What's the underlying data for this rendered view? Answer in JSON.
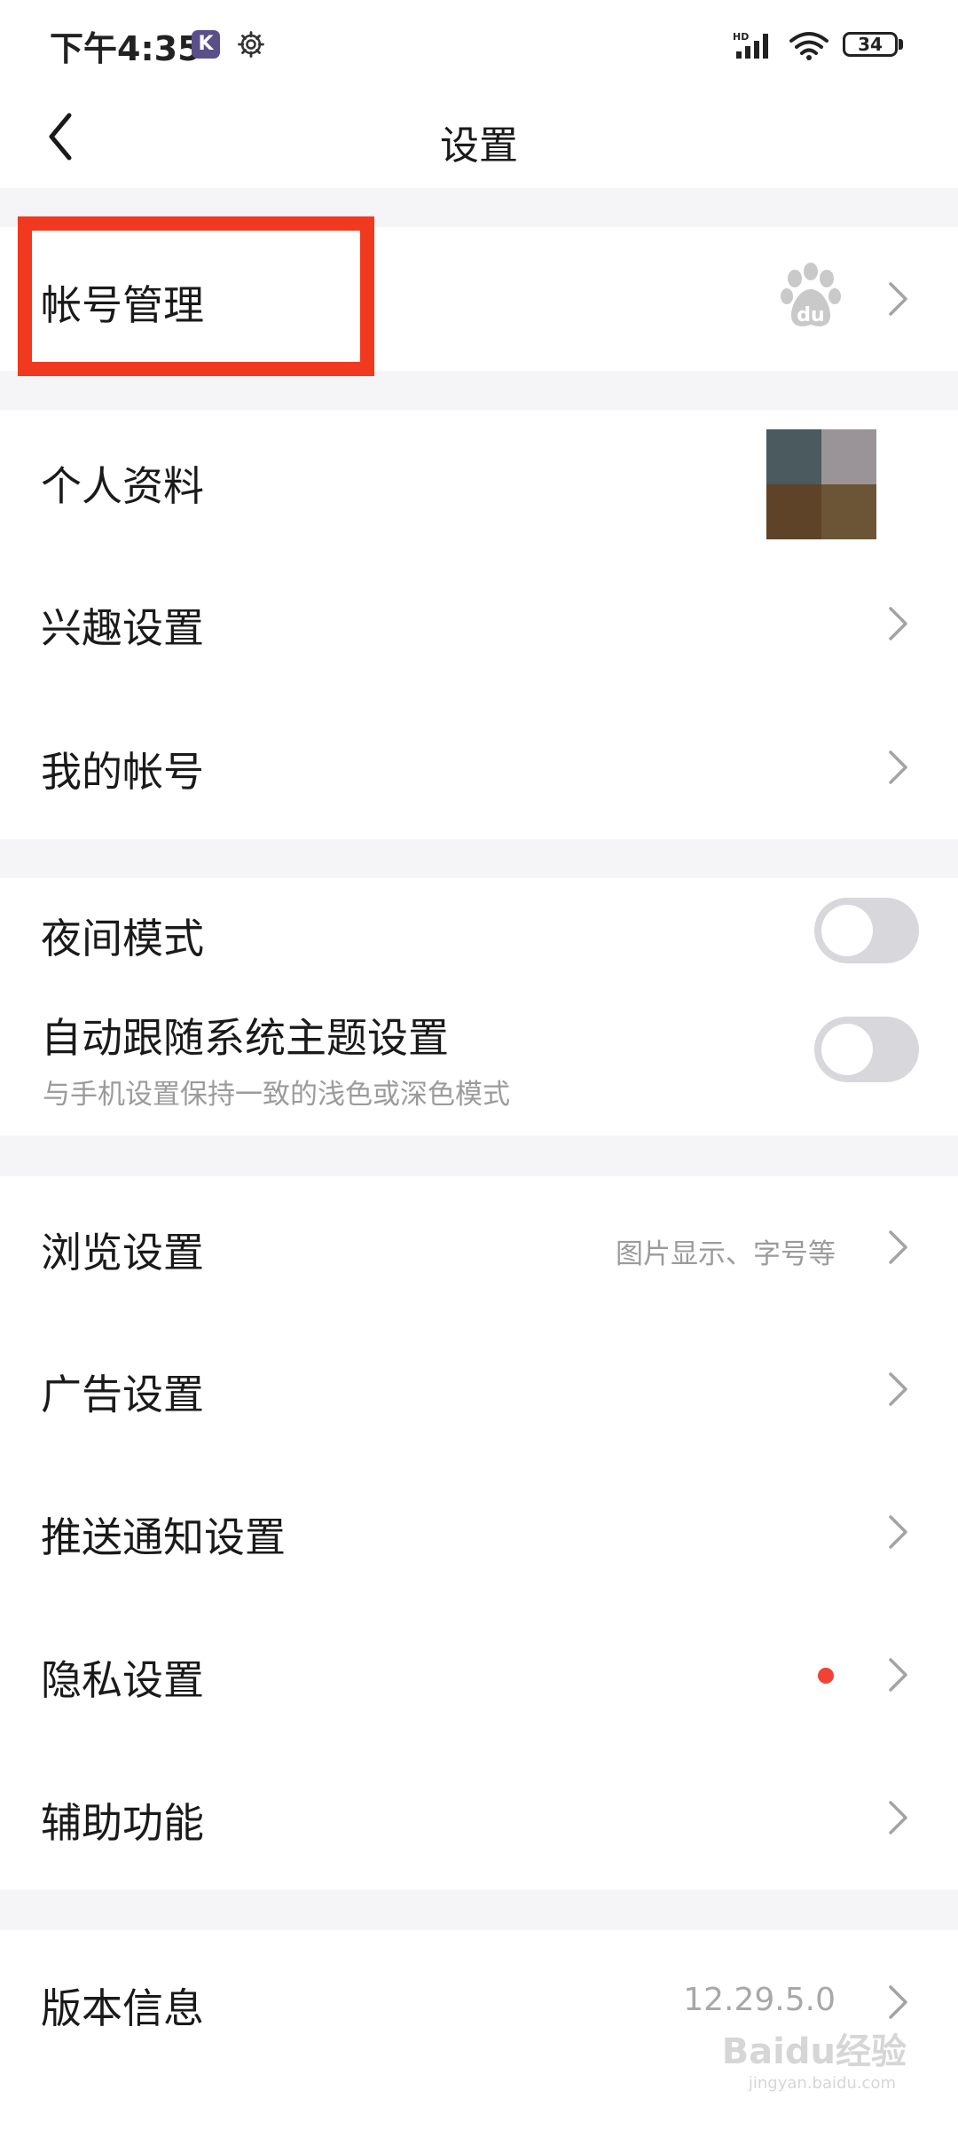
{
  "status_bar": {
    "time": "下午4:35",
    "app_badge": "K",
    "battery": "34"
  },
  "nav": {
    "title": "设置"
  },
  "account_group": {
    "account_management": "帐号管理"
  },
  "profile_group": {
    "personal_info": "个人资料",
    "interest_settings": "兴趣设置",
    "my_account": "我的帐号"
  },
  "theme_group": {
    "night_mode": "夜间模式",
    "night_mode_on": false,
    "follow_system": "自动跟随系统主题设置",
    "follow_system_desc": "与手机设置保持一致的浅色或深色模式",
    "follow_system_on": false
  },
  "settings_group": {
    "browse_settings": "浏览设置",
    "browse_settings_hint": "图片显示、字号等",
    "ad_settings": "广告设置",
    "push_settings": "推送通知设置",
    "privacy_settings": "隐私设置",
    "accessibility": "辅助功能"
  },
  "about_group": {
    "version_info": "版本信息",
    "version": "12.29.5.0"
  },
  "watermark": {
    "brand": "Baidu经验",
    "url": "jingyan.baidu.com"
  },
  "colors": {
    "highlight": "#f0391e",
    "red_dot": "#f04336",
    "toggle_off": "#d7d7dc",
    "section_gap": "#f5f5f7"
  },
  "icons": {
    "back": "chevron-left-icon",
    "row_arrow": "chevron-right-icon",
    "baidu": "baidu-paw-icon"
  }
}
